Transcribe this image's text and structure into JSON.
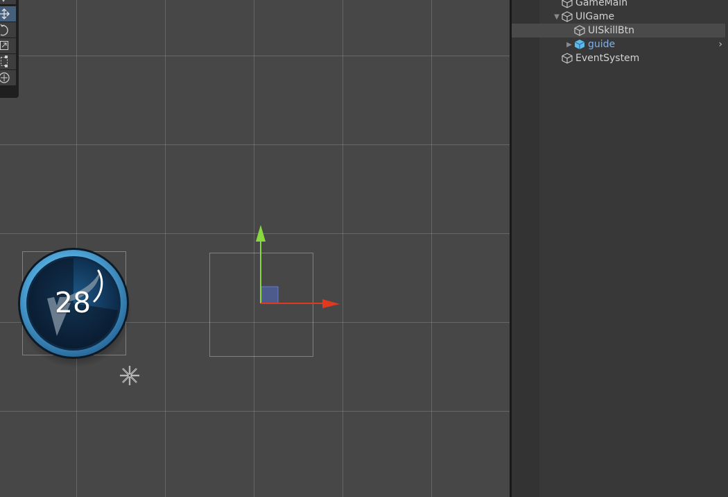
{
  "scene_view": {
    "skill_button": {
      "number": "28"
    }
  },
  "tools": [
    {
      "icon": "view-tool-icon",
      "active": false
    },
    {
      "icon": "move-tool-icon",
      "active": true
    },
    {
      "icon": "rotate-tool-icon",
      "active": false
    },
    {
      "icon": "scale-tool-icon",
      "active": false
    },
    {
      "icon": "rect-tool-icon",
      "active": false
    },
    {
      "icon": "transform-tool-icon",
      "active": false
    }
  ],
  "hierarchy": {
    "items": [
      {
        "label": "GameMain",
        "depth": 1,
        "expanded": null,
        "prefab": false,
        "selected": false
      },
      {
        "label": "UIGame",
        "depth": 1,
        "expanded": true,
        "prefab": false,
        "selected": false
      },
      {
        "label": "UISkillBtn",
        "depth": 2,
        "expanded": null,
        "prefab": false,
        "selected": true
      },
      {
        "label": "guide",
        "depth": 2,
        "expanded": false,
        "prefab": true,
        "selected": false
      },
      {
        "label": "EventSystem",
        "depth": 1,
        "expanded": null,
        "prefab": false,
        "selected": false
      }
    ]
  },
  "colors": {
    "scene_bg": "#474747",
    "selected_tool": "#46607c",
    "x_axis": "#e0391f",
    "y_axis": "#8ad83f",
    "prefab_text": "#7fb2ee"
  }
}
